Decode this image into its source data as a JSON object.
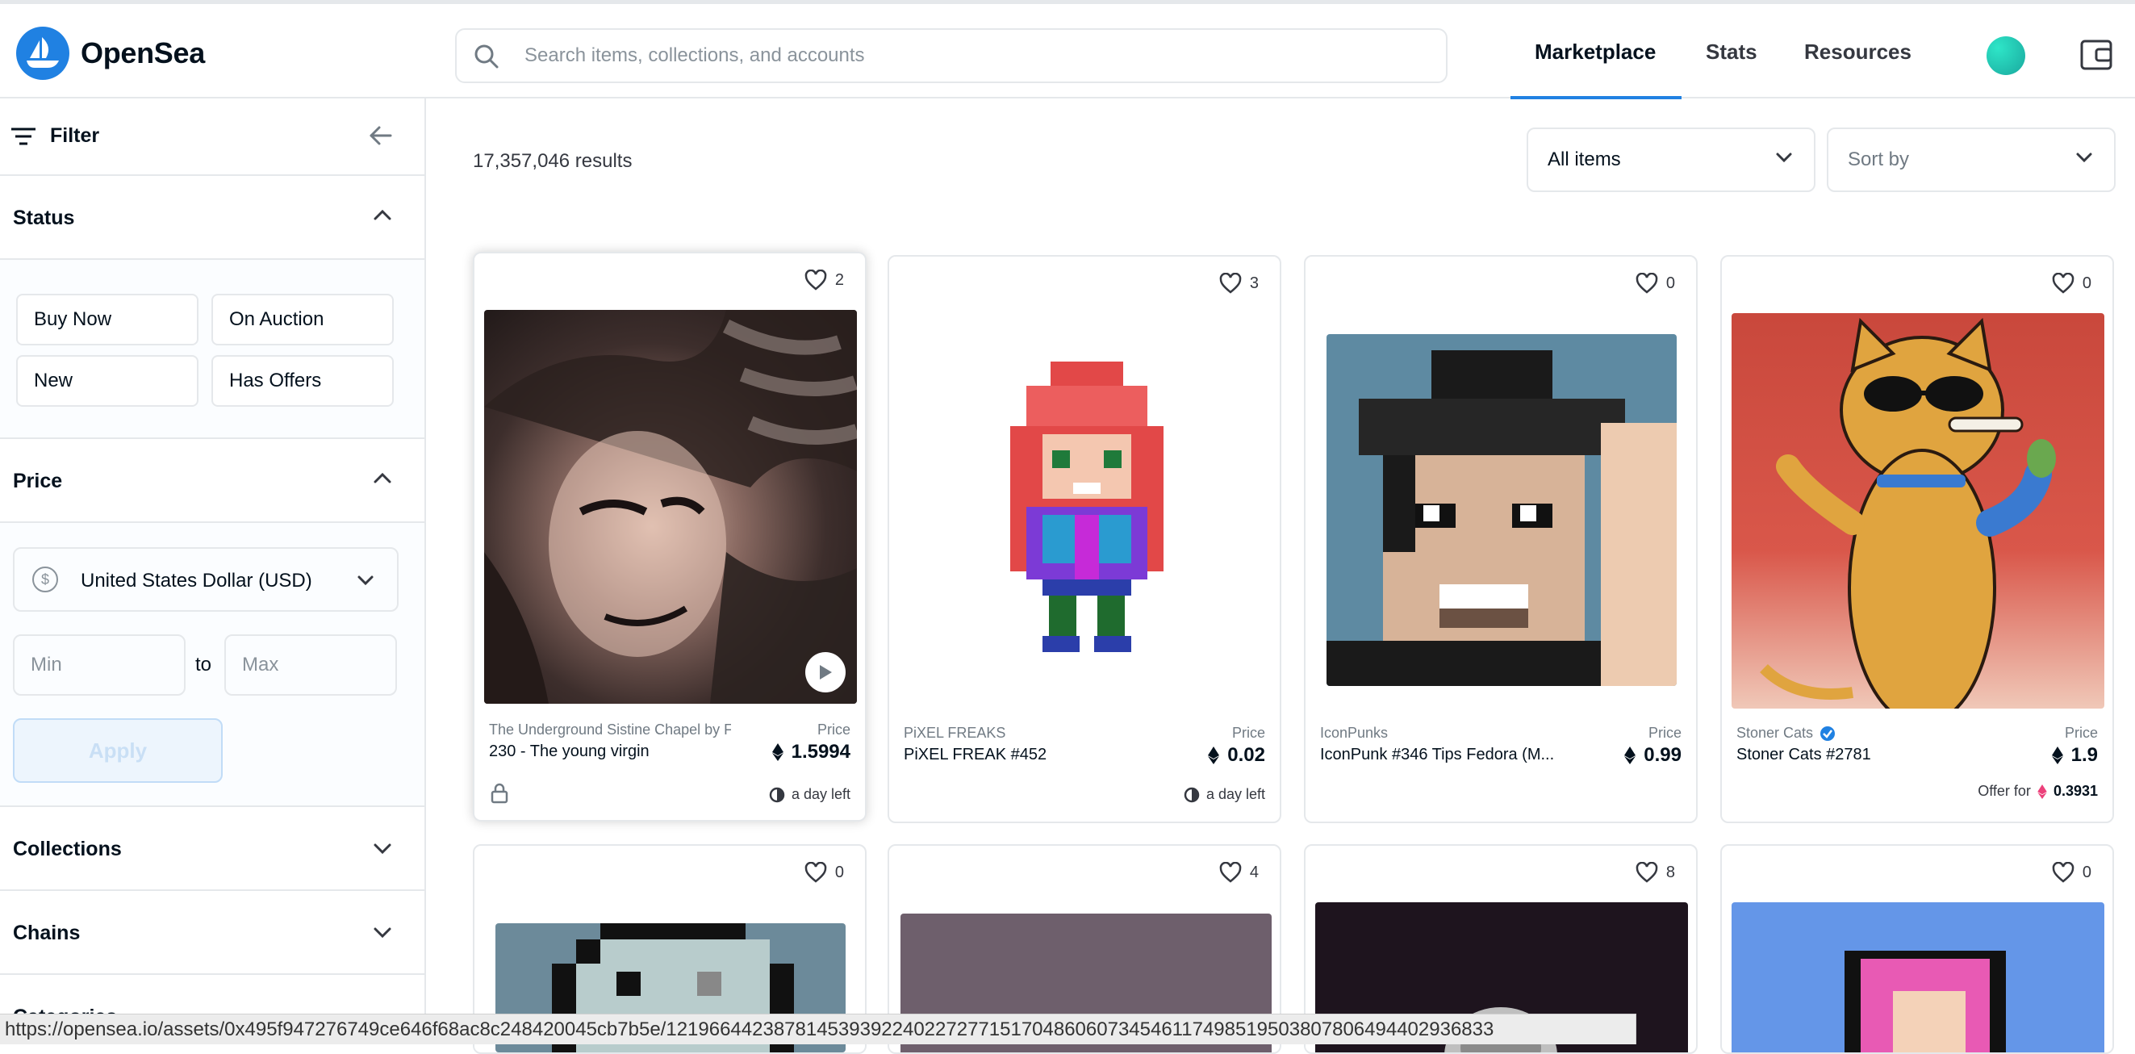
{
  "header": {
    "brand": "OpenSea",
    "search_placeholder": "Search items, collections, and accounts",
    "nav": [
      "Marketplace",
      "Stats",
      "Resources"
    ],
    "accent": "#2081e2"
  },
  "sidebar": {
    "filter_label": "Filter",
    "status": {
      "title": "Status",
      "buttons": [
        "Buy Now",
        "On Auction",
        "New",
        "Has Offers"
      ]
    },
    "price": {
      "title": "Price",
      "currency": "United States Dollar (USD)",
      "currency_symbol": "$",
      "min_placeholder": "Min",
      "max_placeholder": "Max",
      "to": "to",
      "apply": "Apply"
    },
    "collections": "Collections",
    "chains": "Chains",
    "categories": "Categories"
  },
  "main": {
    "results": "17,357,046 results",
    "filter_dropdown": "All items",
    "sort_dropdown": "Sort by"
  },
  "cards": [
    {
      "favorites": "2",
      "collection": "The Underground Sistine Chapel by F",
      "name": "230 - The young virgin",
      "price_label": "Price",
      "price": "1.5994",
      "time_left": "a day left"
    },
    {
      "favorites": "3",
      "collection": "PiXEL FREAKS",
      "name": "PiXEL FREAK #452",
      "price_label": "Price",
      "price": "0.02",
      "time_left": "a day left"
    },
    {
      "favorites": "0",
      "collection": "IconPunks",
      "name": "IconPunk #346 Tips Fedora (M...",
      "price_label": "Price",
      "price": "0.99"
    },
    {
      "favorites": "0",
      "collection": "Stoner Cats",
      "name": "Stoner Cats #2781",
      "price_label": "Price",
      "price": "1.9",
      "offer_label": "Offer for",
      "offer_value": "0.3931"
    }
  ],
  "cards_row2": [
    {
      "favorites": "0"
    },
    {
      "favorites": "4"
    },
    {
      "favorites": "8"
    },
    {
      "favorites": "0"
    }
  ],
  "statusbar": "https://opensea.io/assets/0x495f947276749ce646f68ac8c248420045cb7b5e/12196644238781453939224022727715170486060734546117498519503807806494402936833"
}
